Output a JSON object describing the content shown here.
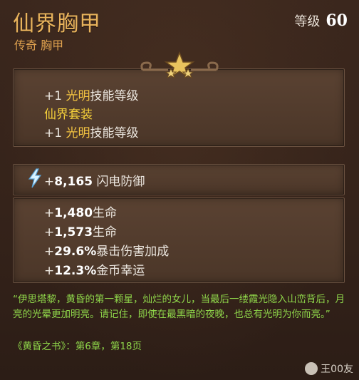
{
  "item": {
    "name": "仙界胸甲",
    "rarity_type": "传奇 胸甲",
    "level_label": "等级",
    "level_value": "60"
  },
  "bonus_section": {
    "row1": {
      "prefix": "+1 ",
      "highlight": "光明",
      "suffix": "技能等级"
    },
    "set_name": "仙界套装",
    "row2": {
      "prefix": "+1 ",
      "highlight": "光明",
      "suffix": "技能等级"
    }
  },
  "primary_stat": {
    "plus": "+",
    "value": "8,165",
    "label": "闪电防御",
    "icon": "lightning-bolt-icon"
  },
  "secondary_stats": [
    {
      "plus": "+",
      "value": "1,480",
      "label": "生命"
    },
    {
      "plus": "+",
      "value": "1,573",
      "label": "生命"
    },
    {
      "plus": "+",
      "value": "29.6%",
      "label": "暴击伤害加成"
    },
    {
      "plus": "+",
      "value": "12.3%",
      "label": "金币幸运"
    }
  ],
  "lore": {
    "text": "“伊思塔黎，黄昏的第一颗星，灿烂的女儿，当最后一缕霞光隐入山峦背后，月亮的光晕更加明亮。请记住，即使在最黑暗的夜晚，也总有光明为你而亮。”",
    "source": "《黄昏之书》：第6章，第18页"
  },
  "watermark": {
    "text": "王00友",
    "icon": "shield-icon"
  },
  "colors": {
    "title": "#e8b35c",
    "highlight": "#f5c542",
    "lore": "#8fd64a",
    "panel": "#4b3628"
  }
}
